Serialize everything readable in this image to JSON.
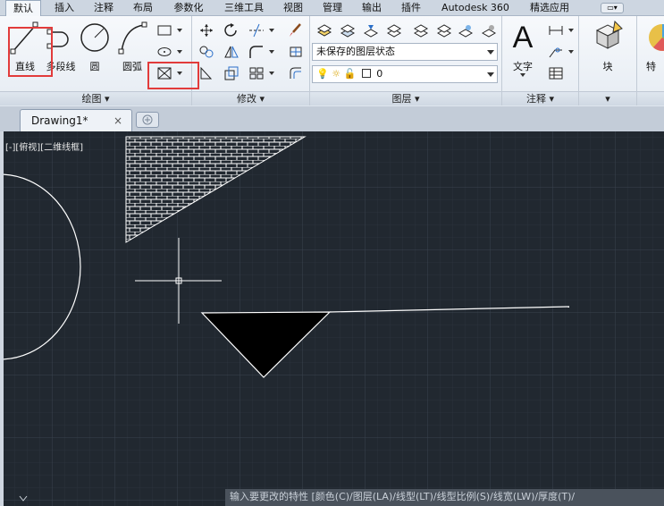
{
  "menu": {
    "tabs": [
      "默认",
      "插入",
      "注释",
      "布局",
      "参数化",
      "三维工具",
      "视图",
      "管理",
      "输出",
      "插件",
      "Autodesk 360",
      "精选应用"
    ],
    "active": "默认"
  },
  "ribbon": {
    "draw": {
      "title": "绘图",
      "line_label": "直线",
      "polyline_label": "多段线",
      "circle_label": "圆",
      "arc_label": "圆弧"
    },
    "modify": {
      "title": "修改"
    },
    "layers": {
      "title": "图层",
      "state_value": "未保存的图层状态",
      "current_layer": "0"
    },
    "annotation": {
      "title": "注释",
      "text_label": "文字"
    },
    "block": {
      "label": "块"
    },
    "properties": {
      "label": "特"
    }
  },
  "doc": {
    "tab_name": "Drawing1*",
    "close_glyph": "×"
  },
  "canvas": {
    "view_label": "[-][俯视][二维线框]"
  },
  "command_line": {
    "prompt": "输入要更改的特性 [颜色(C)/图层(LA)/线型(LT)/线型比例(S)/线宽(LW)/厚度(T)/"
  },
  "colors": {
    "canvas_bg": "#212830",
    "highlight": "#e23b3b"
  }
}
